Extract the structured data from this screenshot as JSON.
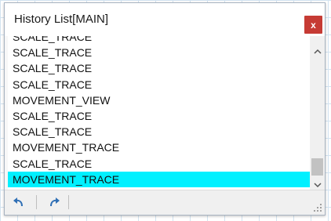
{
  "window": {
    "title": "History List[MAIN]",
    "close_label": "x"
  },
  "history": {
    "items": [
      {
        "label": "SCALE_TRACE"
      },
      {
        "label": "SCALE_TRACE"
      },
      {
        "label": "SCALE_TRACE"
      },
      {
        "label": "SCALE_TRACE"
      },
      {
        "label": "MOVEMENT_VIEW"
      },
      {
        "label": "SCALE_TRACE"
      },
      {
        "label": "SCALE_TRACE"
      },
      {
        "label": "MOVEMENT_TRACE"
      },
      {
        "label": "SCALE_TRACE"
      },
      {
        "label": "MOVEMENT_TRACE",
        "selected": true
      }
    ]
  },
  "toolbar": {
    "undo_icon": "undo-icon",
    "redo_icon": "redo-icon"
  },
  "colors": {
    "selection": "#00f0ff",
    "close_button": "#c63b34",
    "toolbar_icon": "#2f6fb5"
  }
}
